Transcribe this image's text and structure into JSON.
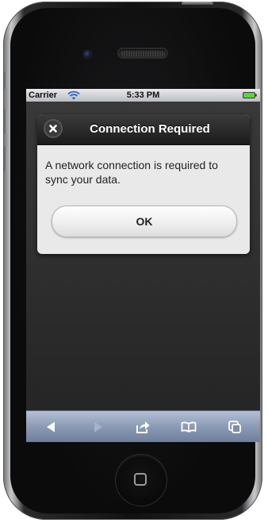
{
  "status_bar": {
    "carrier": "Carrier",
    "time": "5:33 PM",
    "wifi_icon": "wifi-icon",
    "battery_icon": "battery-full-icon",
    "battery_color": "#5fd33a"
  },
  "alert": {
    "title": "Connection Required",
    "message": "A network connection is required to sync your data.",
    "ok_label": "OK",
    "close_icon": "close-icon"
  },
  "toolbar": {
    "items": [
      {
        "icon": "back-arrow-icon",
        "enabled": true
      },
      {
        "icon": "forward-arrow-icon",
        "enabled": false
      },
      {
        "icon": "share-icon",
        "enabled": true
      },
      {
        "icon": "bookmarks-icon",
        "enabled": true
      },
      {
        "icon": "tabs-icon",
        "enabled": true
      }
    ]
  },
  "colors": {
    "toolbar_tint": "#8b9ab5",
    "alert_header": "#1b1b1b",
    "alert_body": "#e9e9e9"
  }
}
